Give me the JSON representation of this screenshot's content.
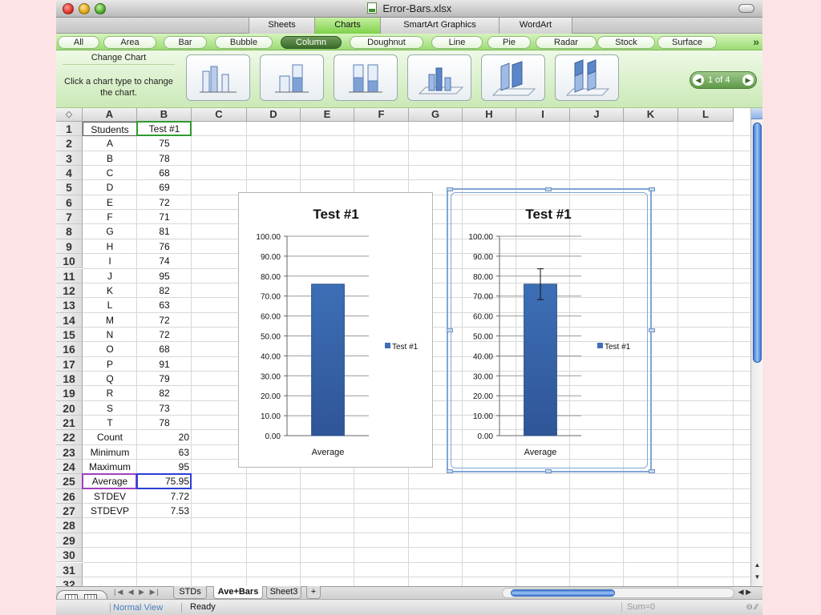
{
  "window": {
    "title": "Error-Bars.xlsx"
  },
  "ribbon": {
    "tabs": [
      {
        "label": "Sheets"
      },
      {
        "label": "Charts"
      },
      {
        "label": "SmartArt Graphics"
      },
      {
        "label": "WordArt"
      }
    ],
    "active_tab": "Charts",
    "chart_types": [
      {
        "label": "All"
      },
      {
        "label": "Area"
      },
      {
        "label": "Bar"
      },
      {
        "label": "Bubble"
      },
      {
        "label": "Column"
      },
      {
        "label": "Doughnut"
      },
      {
        "label": "Line"
      },
      {
        "label": "Pie"
      },
      {
        "label": "Radar"
      },
      {
        "label": "Stock"
      },
      {
        "label": "Surface"
      }
    ],
    "active_chart_type": "Column",
    "more_icon": "double-chevron-right-icon",
    "gallery": {
      "title": "Change Chart",
      "hint": "Click a chart type to change the chart.",
      "thumbnails": [
        "clustered-column",
        "stacked-column",
        "100-stacked-column",
        "3d-clustered-column",
        "3d-stacked-column",
        "3d-100-stacked-column"
      ],
      "page_indicator": "1 of 4"
    }
  },
  "sheet": {
    "columns": [
      "A",
      "B",
      "C",
      "D",
      "E",
      "F",
      "G",
      "H",
      "I",
      "J",
      "K",
      "L"
    ],
    "rows": [
      "1",
      "2",
      "3",
      "4",
      "5",
      "6",
      "7",
      "8",
      "9",
      "10",
      "11",
      "12",
      "13",
      "14",
      "15",
      "16",
      "17",
      "18",
      "19",
      "20",
      "21",
      "22",
      "23",
      "24",
      "25",
      "26",
      "27",
      "28",
      "29",
      "30",
      "31",
      "32"
    ],
    "header": {
      "a": "Students",
      "b": "Test #1"
    },
    "students": [
      {
        "name": "A",
        "score": "75"
      },
      {
        "name": "B",
        "score": "78"
      },
      {
        "name": "C",
        "score": "68"
      },
      {
        "name": "D",
        "score": "69"
      },
      {
        "name": "E",
        "score": "72"
      },
      {
        "name": "F",
        "score": "71"
      },
      {
        "name": "G",
        "score": "81"
      },
      {
        "name": "H",
        "score": "76"
      },
      {
        "name": "I",
        "score": "74"
      },
      {
        "name": "J",
        "score": "95"
      },
      {
        "name": "K",
        "score": "82"
      },
      {
        "name": "L",
        "score": "63"
      },
      {
        "name": "M",
        "score": "72"
      },
      {
        "name": "N",
        "score": "72"
      },
      {
        "name": "O",
        "score": "68"
      },
      {
        "name": "P",
        "score": "91"
      },
      {
        "name": "Q",
        "score": "79"
      },
      {
        "name": "R",
        "score": "82"
      },
      {
        "name": "S",
        "score": "73"
      },
      {
        "name": "T",
        "score": "78"
      }
    ],
    "stats": [
      {
        "label": "Count",
        "value": "20"
      },
      {
        "label": "Minimum",
        "value": "63"
      },
      {
        "label": "Maximum",
        "value": "95"
      },
      {
        "label": "Average",
        "value": "75.95"
      },
      {
        "label": "STDEV",
        "value": "7.72"
      },
      {
        "label": "STDEVP",
        "value": "7.53"
      }
    ]
  },
  "chart_data": [
    {
      "type": "bar",
      "title": "Test #1",
      "categories": [
        "Average"
      ],
      "series": [
        {
          "name": "Test #1",
          "values": [
            75.95
          ],
          "color": "#3d6fb6"
        }
      ],
      "ylim": [
        0,
        100
      ],
      "ytick_step": 10,
      "ytick_labels": [
        "0.00",
        "10.00",
        "20.00",
        "30.00",
        "40.00",
        "50.00",
        "60.00",
        "70.00",
        "80.00",
        "90.00",
        "100.00"
      ],
      "grid": true,
      "legend": "right",
      "error_bars": null,
      "selected": false
    },
    {
      "type": "bar",
      "title": "Test #1",
      "categories": [
        "Average"
      ],
      "series": [
        {
          "name": "Test #1",
          "values": [
            75.95
          ],
          "color": "#3d6fb6"
        }
      ],
      "ylim": [
        0,
        100
      ],
      "ytick_step": 10,
      "ytick_labels": [
        "0.00",
        "10.00",
        "20.00",
        "30.00",
        "40.00",
        "50.00",
        "60.00",
        "70.00",
        "80.00",
        "90.00",
        "100.00"
      ],
      "grid": true,
      "legend": "right",
      "error_bars": {
        "plus": 7.72,
        "minus": 7.72
      },
      "selected": true
    }
  ],
  "sheet_tabs": {
    "tabs": [
      {
        "label": "STDs"
      },
      {
        "label": "Ave+Bars"
      },
      {
        "label": "Sheet3"
      }
    ],
    "active": "Ave+Bars",
    "add_label": "+"
  },
  "status": {
    "view": "Normal View",
    "ready": "Ready",
    "sum": "Sum=0"
  }
}
